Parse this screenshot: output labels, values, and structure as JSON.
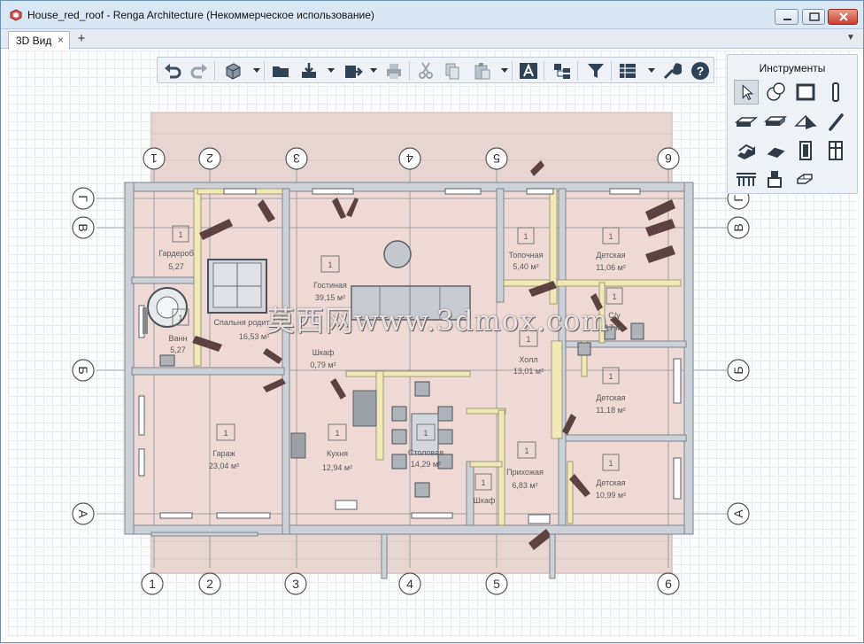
{
  "window": {
    "title": "House_red_roof - Renga Architecture (Некоммерческое использование)"
  },
  "tabs": [
    {
      "label": "3D Вид",
      "close": "×"
    }
  ],
  "tab_add": "+",
  "tab_menu": "▼",
  "toolbar": {
    "items": [
      "undo-icon",
      "redo-icon",
      "view-cube-icon",
      "open-folder-icon",
      "import-icon",
      "export-icon",
      "print-icon",
      "cut-icon",
      "copy-icon",
      "paste-icon",
      "text-icon",
      "layers-icon",
      "filter-icon",
      "schedule-icon",
      "settings-wrench-icon",
      "help-icon"
    ]
  },
  "tools": {
    "title": "Инструменты",
    "items": [
      "select-icon",
      "primitive-icon",
      "wall-icon",
      "column-icon",
      "beam-icon",
      "slab-icon",
      "roof-icon",
      "line-icon",
      "stair-icon",
      "ramp-icon",
      "door-icon",
      "window-icon",
      "railing-icon",
      "equipment-icon",
      "opening-icon"
    ]
  },
  "grid_axes": {
    "top": [
      "1",
      "2",
      "3",
      "4",
      "5",
      "6"
    ],
    "bottom": [
      "1",
      "2",
      "3",
      "4",
      "5",
      "6"
    ],
    "left": [
      "Г",
      "В",
      "Б",
      "А"
    ],
    "right": [
      "Г",
      "В",
      "Б",
      "А"
    ]
  },
  "rooms": [
    {
      "num": "1",
      "name": "Гардероб",
      "area": "5,27"
    },
    {
      "num": "1",
      "name": "Ванн",
      "area": "5,27"
    },
    {
      "num": "1",
      "name": "Спальня родит",
      "area": "16,53 м²"
    },
    {
      "num": "1",
      "name": "Гостиная",
      "area": "39,15 м²"
    },
    {
      "num": "1",
      "name": "Топочная",
      "area": "5,40 м²"
    },
    {
      "num": "1",
      "name": "Детская",
      "area": "11,06 м²"
    },
    {
      "num": "1",
      "name": "С/у",
      "area": "17 м²"
    },
    {
      "num": "1",
      "name": "Шкаф",
      "area": "0,79 м²"
    },
    {
      "num": "1",
      "name": "Холл",
      "area": "13,01 м²"
    },
    {
      "num": "1",
      "name": "Детская",
      "area": "11,18 м²"
    },
    {
      "num": "1",
      "name": "Гараж",
      "area": "23,04 м²"
    },
    {
      "num": "1",
      "name": "Кухня",
      "area": "12,94 м²"
    },
    {
      "num": "1",
      "name": "Столовая",
      "area": "14,29 м²"
    },
    {
      "num": "1",
      "name": "Прихожая",
      "area": "6,83 м²"
    },
    {
      "num": "1",
      "name": "Шкаф",
      "area": ""
    },
    {
      "num": "1",
      "name": "Детская",
      "area": "10,99 м²"
    }
  ],
  "watermark": "莫西网www.3dmox.com",
  "colors": {
    "roof": "#e6d5d0",
    "floor": "#eed9d4",
    "wall": "#cdd2d8",
    "partition": "#f1e8b7",
    "furniture": "#6b4a4a",
    "accent_close": "#c7402c"
  }
}
